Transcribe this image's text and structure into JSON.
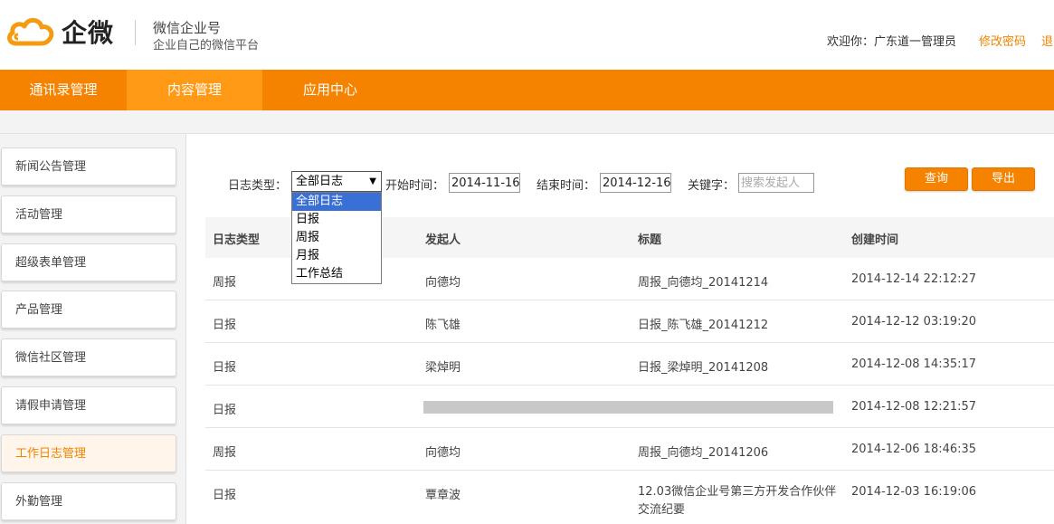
{
  "header": {
    "logo_text": "企微",
    "brand_title": "微信企业号",
    "brand_subtitle": "企业自己的微信平台",
    "welcome": "欢迎你：广东道一管理员",
    "change_password": "修改密码",
    "logout": "退出"
  },
  "nav": {
    "items": [
      {
        "label": "通讯录管理"
      },
      {
        "label": "内容管理"
      },
      {
        "label": "应用中心"
      }
    ]
  },
  "sidebar": {
    "items": [
      {
        "label": "新闻公告管理"
      },
      {
        "label": "活动管理"
      },
      {
        "label": "超级表单管理"
      },
      {
        "label": "产品管理"
      },
      {
        "label": "微信社区管理"
      },
      {
        "label": "请假申请管理"
      },
      {
        "label": "工作日志管理"
      },
      {
        "label": "外勤管理"
      }
    ]
  },
  "filters": {
    "log_type_label": "日志类型：",
    "log_type_value": "全部日志",
    "log_type_options": [
      "全部日志",
      "日报",
      "周报",
      "月报",
      "工作总结"
    ],
    "start_label": "开始时间：",
    "start_value": "2014-11-16",
    "end_label": "结束时间：",
    "end_value": "2014-12-16",
    "keyword_label": "关键字：",
    "keyword_placeholder": "搜索发起人",
    "query_button": "查询",
    "export_button": "导出"
  },
  "table": {
    "headers": [
      "日志类型",
      "发起人",
      "标题",
      "创建时间"
    ],
    "rows": [
      {
        "type": "周报",
        "author": "向德均",
        "title": "周报_向德均_20141214",
        "created": "2014-12-14 22:12:27"
      },
      {
        "type": "日报",
        "author": "陈飞雄",
        "title": "日报_陈飞雄_20141212",
        "created": "2014-12-12 03:19:20"
      },
      {
        "type": "日报",
        "author": "梁焯明",
        "title": "日报_梁焯明_20141208",
        "created": "2014-12-08 14:35:17"
      },
      {
        "type": "日报",
        "author": "",
        "title": "",
        "created": "2014-12-08 12:21:57"
      },
      {
        "type": "周报",
        "author": "向德均",
        "title": "周报_向德均_20141206",
        "created": "2014-12-06 18:46:35"
      },
      {
        "type": "日报",
        "author": "覃章波",
        "title": "12.03微信企业号第三方开发合作伙伴交流纪要",
        "created": "2014-12-03 16:19:06"
      }
    ]
  },
  "colors": {
    "accent": "#f58300",
    "nav_active": "#ff9a16",
    "dropdown_highlight": "#3a70d6"
  }
}
